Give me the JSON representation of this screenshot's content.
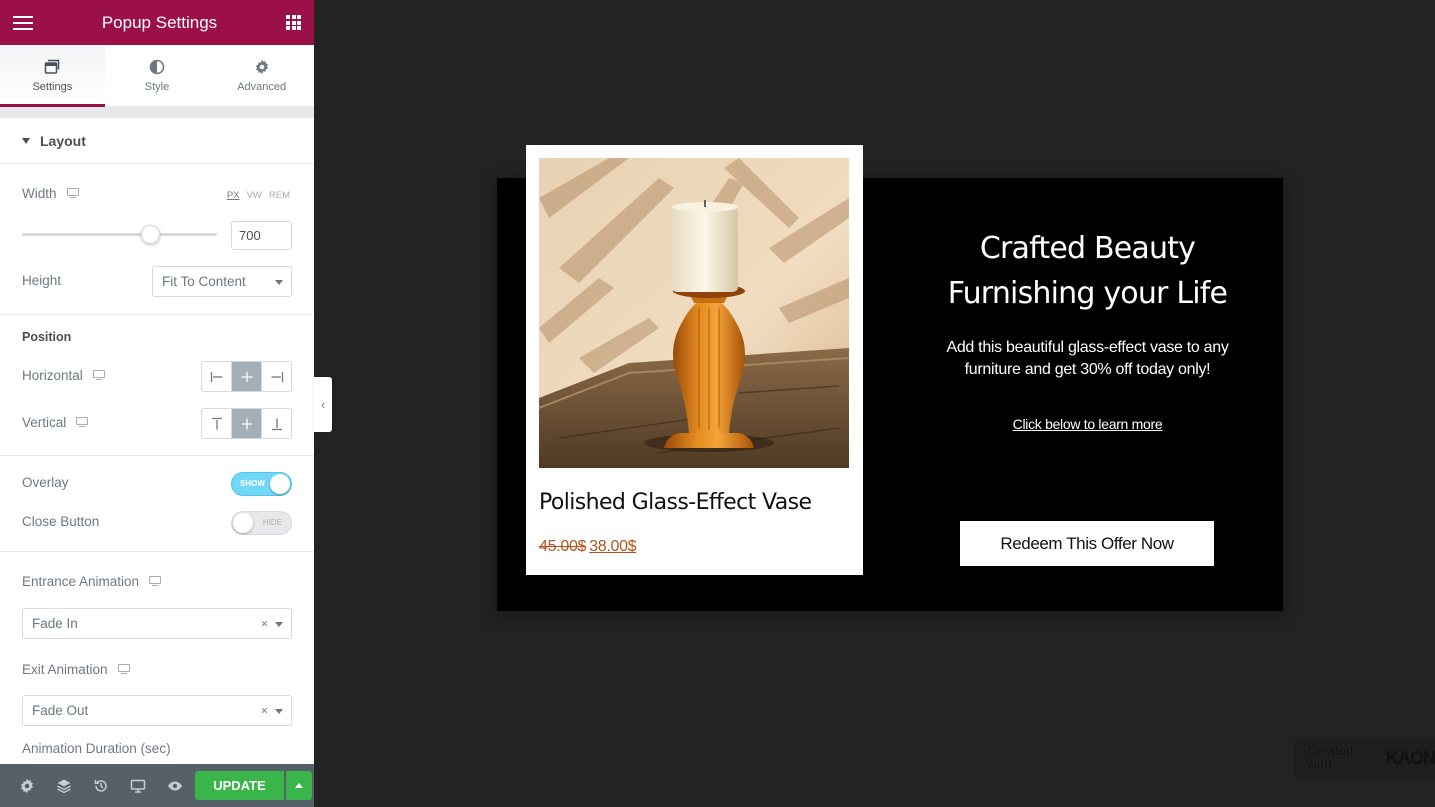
{
  "sidebar": {
    "title": "Popup Settings",
    "tabs": [
      {
        "label": "Settings",
        "icon": "window-icon"
      },
      {
        "label": "Style",
        "icon": "half-circle-icon"
      },
      {
        "label": "Advanced",
        "icon": "gear-icon"
      }
    ],
    "active_tab": "Settings",
    "layout_section": "Layout",
    "width": {
      "label": "Width",
      "units": [
        "PX",
        "VW",
        "REM"
      ],
      "active_unit": "PX",
      "value": "700",
      "slider_fraction": 0.66
    },
    "height": {
      "label": "Height",
      "value": "Fit To Content"
    },
    "position": {
      "heading": "Position",
      "horizontal_label": "Horizontal",
      "vertical_label": "Vertical",
      "horizontal_active": "center",
      "vertical_active": "center"
    },
    "overlay": {
      "label": "Overlay",
      "state": "SHOW"
    },
    "close_button": {
      "label": "Close Button",
      "state": "HIDE"
    },
    "entrance_animation": {
      "label": "Entrance Animation",
      "value": "Fade In"
    },
    "exit_animation": {
      "label": "Exit Animation",
      "value": "Fade Out"
    },
    "animation_duration_label": "Animation Duration (sec)",
    "footer": {
      "update_label": "UPDATE"
    }
  },
  "popup": {
    "product_name": "Polished Glass-Effect Vase",
    "old_price": "45.00$",
    "new_price": "38.00$",
    "headline_line1": "Crafted Beauty",
    "headline_line2": "Furnishing your Life",
    "body_line1": "Add this beautiful glass-effect vase to any",
    "body_line2": "furniture and get 30% off today only!",
    "link_text": "Click below to learn more",
    "cta_label": "Redeem This Offer Now"
  },
  "watermark": {
    "prefix": "Created with",
    "brand": "KAON"
  },
  "colors": {
    "brand_bar": "#9b1048",
    "update_green": "#39b54a",
    "toggle_on": "#71d7f7",
    "canvas_bg": "#232323",
    "price_color": "#b5521e"
  }
}
